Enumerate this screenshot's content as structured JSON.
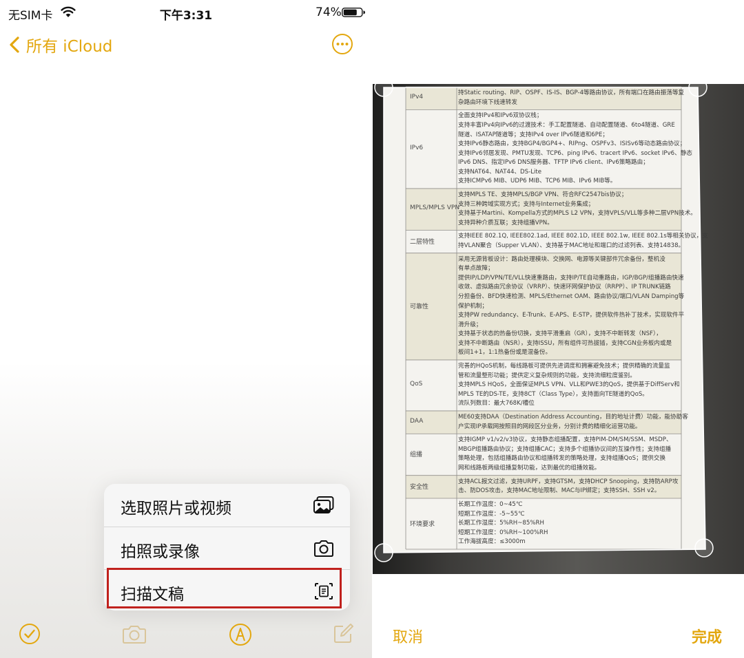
{
  "status_bar": {
    "carrier": "无SIM卡",
    "time": "下午3:31",
    "battery": "74%"
  },
  "nav": {
    "back_label": "所有 iCloud",
    "more_icon": "ellipsis-circle-icon"
  },
  "menu": {
    "items": [
      {
        "label": "选取照片或视频",
        "icon": "photo-library-icon"
      },
      {
        "label": "拍照或录像",
        "icon": "camera-icon"
      },
      {
        "label": "扫描文稿",
        "icon": "doc-scan-icon",
        "highlighted": true
      }
    ]
  },
  "toolbar": {
    "icons": [
      "checklist-icon",
      "camera-icon",
      "markup-icon",
      "compose-icon"
    ]
  },
  "scanner": {
    "cancel_label": "取消",
    "done_label": "完成",
    "document": {
      "rows": [
        {
          "label": "IPv4",
          "lines": [
            "持Static routing、RIP、OSPF、IS-IS、BGP-4等路由协议，所有端口在路由振荡等复",
            "杂路由环境下线速转发"
          ]
        },
        {
          "label": "IPv6",
          "lines": [
            "全面支持IPv4和IPv6双协议栈；",
            "支持丰富IPv4向IPv6的过渡技术：手工配置隧道、自动配置隧道、6to4隧道、GRE",
            "隧道、ISATAP隧道等；支持IPv4 over IPv6隧道和6PE；",
            "支持IPv6静态路由，支持BGP4/BGP4+、RIPng、OSPFv3、ISISv6等动态路由协议；",
            "支持IPv6邻居发现、PMTU发现、TCP6、ping IPv6、tracert IPv6、socket IPv6、静态",
            "IPv6 DNS、指定IPv6 DNS服务器、TFTP IPv6 client、IPv6策略路由；",
            "支持NAT64、NAT44、DS-Lite",
            "支持ICMPv6 MIB、UDP6 MIB、TCP6 MIB、IPv6 MIB等。"
          ]
        },
        {
          "label": "MPLS/MPLS VPN",
          "lines": [
            "支持MPLS TE、支持MPLS/BGP VPN、符合RFC2547bis协议；",
            "支持三种跨域实现方式；支持与Internet业务集成；",
            "支持基于Martini、Kompella方式的MPLS L2 VPN，支持VPLS/VLL等多种二层VPN技术。",
            "支持异种介质互联；支持组播VPN。"
          ]
        },
        {
          "label": "二层特性",
          "lines": [
            "支持IEEE 802.1Q, IEEE802.1ad, IEEE 802.1D, IEEE 802.1w, IEEE 802.1s等相关协议，支",
            "持VLAN聚合（Supper VLAN）、支持基于MAC地址和端口的过滤列表、支持14838。"
          ]
        },
        {
          "label": "可靠性",
          "lines": [
            "采用无源背板设计：路由处理模块、交换网、电源等关键部件冗余备份，整机没",
            "有单点故障；",
            "提供IP/LDP/VPN/TE/VLL快速重路由，支持IP/TE自动重路由，IGP/BGP/组播路由快速",
            "收敛、虚拟路由冗余协议（VRRP）、快速环网保护协议（RRPP）、IP TRUNK链路",
            "分担备份、BFD快速检测、MPLS/Ethernet OAM、路由协议/端口/VLAN Damping等",
            "保护机制；",
            "支持PW redundancy、E-Trunk、E-APS、E-STP，提供软件热补丁技术，实现软件平",
            "滑升级；",
            "支持基于状态的热备份切换，支持平滑重启（GR），支持不中断转发（NSF），",
            "支持不中断路由（NSR），支持ISSU，所有组件可热拔插，支持CGN业务板内或是",
            "板间1+1，1:1热备份或是混备份。"
          ]
        },
        {
          "label": "QoS",
          "lines": [
            "完善的HQoS机制，每线路板可提供先进调度和拥塞避免技术；提供精确的流量监",
            "管和流量整形功能；提供定义复杂规则的功能，支持流细粒度鉴别。",
            "支持MPLS HQoS，全面保证MPLS VPN、VLL和PWE3的QoS，提供基于DiffServ和",
            "MPLS TE的DS-TE，支持8CT（Class Type），支持面向TE隧道的QoS。",
            "流队列数目：最大768K/槽位"
          ]
        },
        {
          "label": "DAA",
          "lines": [
            "ME60支持DAA（Destination Address Accounting，目的地址计费）功能，能协助客",
            "户实现IP承载网按照目的网段区分业务，分别计费的精细化运营功能。"
          ]
        },
        {
          "label": "组播",
          "lines": [
            "支持IGMP v1/v2/v3协议，支持静态组播配置，支持PIM-DM/SM/SSM、MSDP、",
            "MBGP组播路由协议；支持组播CAC；支持多个组播协议间的互操作性；支持组播",
            "策略处理，包括组播路由协议和组播转发的策略处理，支持组播QoS；提供交换",
            "网和线路板两级组播复制功能，达到最优的组播效能。"
          ]
        },
        {
          "label": "安全性",
          "lines": [
            "支持ACL报文过滤，支持URPF，支持GTSM，支持DHCP Snooping，支持防ARP攻",
            "击、防DOS攻击，支持MAC地址限制、MAC与IP绑定；支持SSH、SSH v2。"
          ]
        },
        {
          "label": "环境要求",
          "lines": [
            "长期工作温度：0~45℃",
            "短期工作温度：-5~55℃",
            "长期工作湿度：5%RH~85%RH",
            "短期工作湿度：0%RH~100%RH",
            "工作海拔高度：≤3000m"
          ]
        }
      ]
    }
  }
}
